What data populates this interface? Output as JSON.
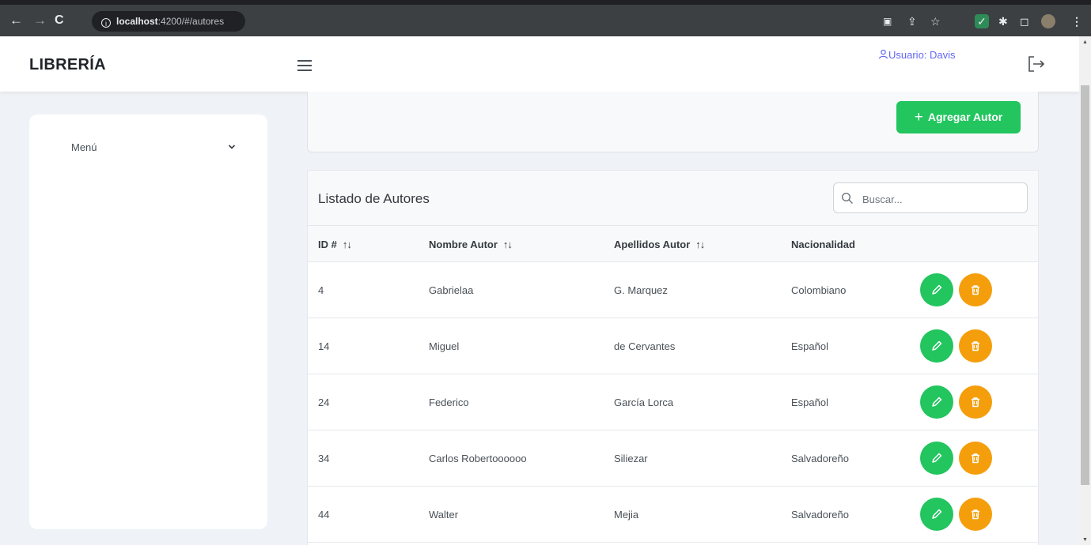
{
  "browser": {
    "url_host": "localhost",
    "url_path": ":4200/#/autores",
    "info_glyph": "i"
  },
  "header": {
    "logo": "LIBRERÍA",
    "user_label": "Usuario: Davis"
  },
  "sidebar": {
    "menu_label": "Menú"
  },
  "toolbar": {
    "add_label": "Agregar Autor"
  },
  "table": {
    "title": "Listado de Autores",
    "search_placeholder": "Buscar...",
    "sort_glyph": "↑↓",
    "columns": [
      "ID #",
      "Nombre Autor",
      "Apellidos Autor",
      "Nacionalidad"
    ],
    "rows": [
      {
        "id": "4",
        "nombre": "Gabrielaa",
        "apellidos": "G. Marquez",
        "nacionalidad": "Colombiano"
      },
      {
        "id": "14",
        "nombre": "Miguel",
        "apellidos": "de Cervantes",
        "nacionalidad": "Español"
      },
      {
        "id": "24",
        "nombre": "Federico",
        "apellidos": "García Lorca",
        "nacionalidad": "Español"
      },
      {
        "id": "34",
        "nombre": "Carlos Robertoooooo",
        "apellidos": "Siliezar",
        "nacionalidad": "Salvadoreño"
      },
      {
        "id": "44",
        "nombre": "Walter",
        "apellidos": "Mejia",
        "nacionalidad": "Salvadoreño"
      }
    ]
  },
  "colors": {
    "primary_green": "#22c55e",
    "warning_orange": "#f59e0b",
    "user_accent": "#6366f1"
  },
  "icons": {
    "back": "arrow-left-icon",
    "forward": "arrow-right-icon",
    "reload": "reload-icon",
    "menu": "hamburger-icon",
    "user": "user-icon",
    "logout": "logout-icon",
    "chevron": "chevron-down-icon",
    "search": "search-icon",
    "edit": "pencil-icon",
    "delete": "trash-icon"
  }
}
